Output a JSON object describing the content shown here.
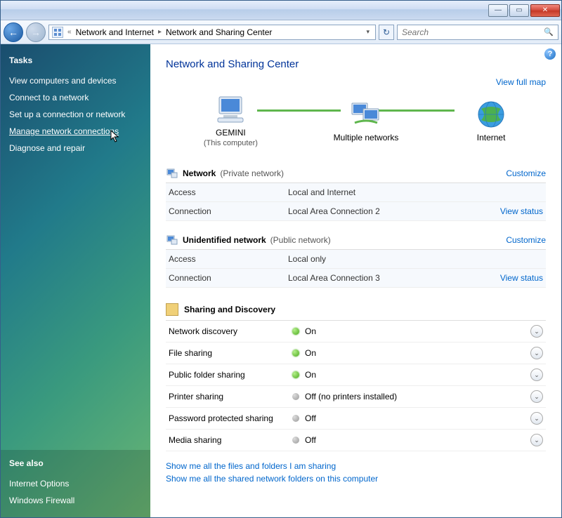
{
  "toolbar": {
    "breadcrumb": [
      "Network and Internet",
      "Network and Sharing Center"
    ],
    "search_placeholder": "Search"
  },
  "sidebar": {
    "tasks_heading": "Tasks",
    "tasks": [
      "View computers and devices",
      "Connect to a network",
      "Set up a connection or network",
      "Manage network connections",
      "Diagnose and repair"
    ],
    "seealso_heading": "See also",
    "seealso": [
      "Internet Options",
      "Windows Firewall"
    ]
  },
  "main": {
    "title": "Network and Sharing Center",
    "view_full_map": "View full map",
    "nodes": {
      "computer": {
        "name": "GEMINI",
        "sub": "(This computer)"
      },
      "middle": {
        "name": "Multiple networks"
      },
      "internet": {
        "name": "Internet"
      }
    },
    "networks": [
      {
        "name": "Network",
        "type": "(Private network)",
        "customize": "Customize",
        "rows": [
          {
            "label": "Access",
            "value": "Local and Internet",
            "link": ""
          },
          {
            "label": "Connection",
            "value": "Local Area Connection 2",
            "link": "View status"
          }
        ]
      },
      {
        "name": "Unidentified network",
        "type": "(Public network)",
        "customize": "Customize",
        "rows": [
          {
            "label": "Access",
            "value": "Local only",
            "link": ""
          },
          {
            "label": "Connection",
            "value": "Local Area Connection 3",
            "link": "View status"
          }
        ]
      }
    ],
    "sharing_heading": "Sharing and Discovery",
    "sharing": [
      {
        "label": "Network discovery",
        "on": true,
        "value": "On"
      },
      {
        "label": "File sharing",
        "on": true,
        "value": "On"
      },
      {
        "label": "Public folder sharing",
        "on": true,
        "value": "On"
      },
      {
        "label": "Printer sharing",
        "on": false,
        "value": "Off (no printers installed)"
      },
      {
        "label": "Password protected sharing",
        "on": false,
        "value": "Off"
      },
      {
        "label": "Media sharing",
        "on": false,
        "value": "Off"
      }
    ],
    "bottom_links": [
      "Show me all the files and folders I am sharing",
      "Show me all the shared network folders on this computer"
    ]
  }
}
